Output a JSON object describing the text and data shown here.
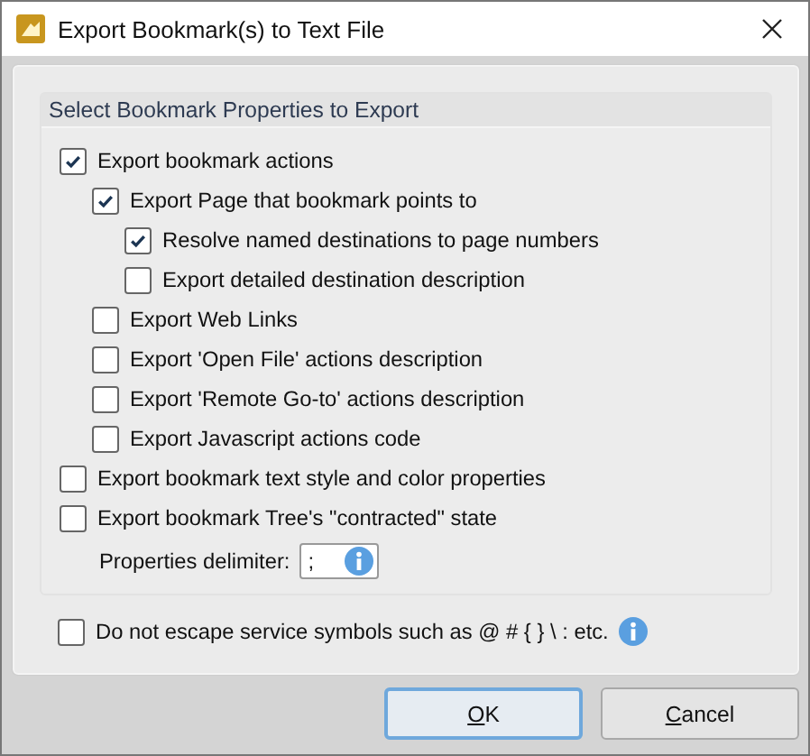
{
  "window": {
    "title": "Export Bookmark(s) to Text File"
  },
  "group": {
    "title": "Select Bookmark Properties to Export",
    "options": [
      {
        "label": "Export bookmark actions",
        "checked": true,
        "children": [
          {
            "label": "Export Page that bookmark points to",
            "checked": true,
            "children": [
              {
                "label": "Resolve named destinations to page numbers",
                "checked": true
              },
              {
                "label": "Export detailed destination description",
                "checked": false
              }
            ]
          },
          {
            "label": "Export Web Links",
            "checked": false
          },
          {
            "label": "Export 'Open File' actions description",
            "checked": false
          },
          {
            "label": "Export 'Remote Go-to' actions description",
            "checked": false
          },
          {
            "label": "Export Javascript actions code",
            "checked": false
          }
        ]
      },
      {
        "label": "Export bookmark text style and color properties",
        "checked": false
      },
      {
        "label": "Export bookmark Tree's \"contracted\" state",
        "checked": false
      }
    ],
    "delimiter": {
      "label": "Properties delimiter:",
      "value": ";"
    }
  },
  "escape_option": {
    "label": "Do not escape service symbols such as @ # { } \\ : etc.",
    "checked": false
  },
  "buttons": [
    {
      "label": "OK",
      "default": true
    },
    {
      "label": "Cancel",
      "default": false
    }
  ]
}
